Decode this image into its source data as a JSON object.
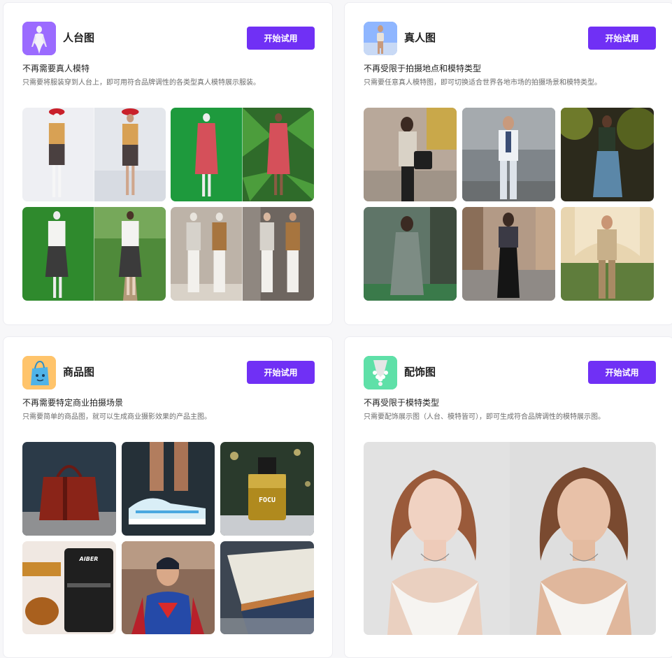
{
  "cards": [
    {
      "title": "人台图",
      "button_label": "开始试用",
      "heading": "不再需要真人模特",
      "description": "只需要将服装穿到人台上，即可用符合品牌调性的各类型真人模特展示服装。",
      "icon": "mannequin-icon",
      "icon_bg": "#9b6bff"
    },
    {
      "title": "真人图",
      "button_label": "开始试用",
      "heading": "不再受限于拍摄地点和模特类型",
      "description": "只需要任意真人模特图，即可切换适合世界各地市场的拍摄场景和模特类型。",
      "icon": "model-icon",
      "icon_bg": "#6fa3ff"
    },
    {
      "title": "商品图",
      "button_label": "开始试用",
      "heading": "不再需要特定商业拍摄场景",
      "description": "只需要简单的商品图，就可以生成商业摄影效果的产品主图。",
      "icon": "shopping-bag-icon",
      "icon_bg": "#ffc46b"
    },
    {
      "title": "配饰图",
      "button_label": "开始试用",
      "heading": "不再受限于模特类型",
      "description": "只需要配饰展示图（人台、模特皆可），即可生成符合品牌调性的模特展示图。",
      "icon": "necklace-icon",
      "icon_bg": "#5fe0a8"
    }
  ],
  "product_labels": {
    "fryer_brand": "AIBER",
    "perfume_brand": "FOCU"
  },
  "colors": {
    "accent": "#7030f5",
    "card_bg": "#ffffff",
    "page_bg": "#f7f7f9"
  }
}
